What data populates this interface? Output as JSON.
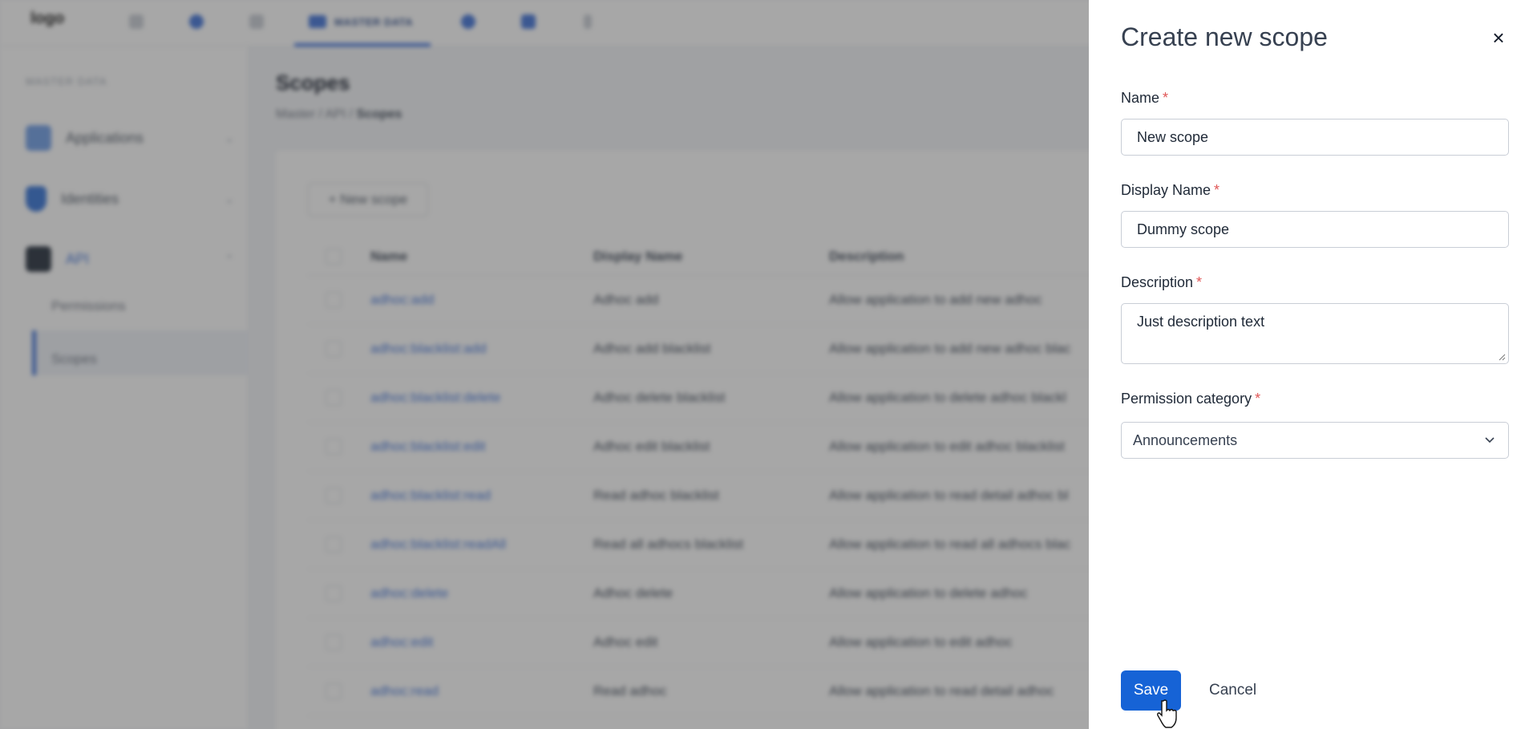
{
  "app": {
    "logo_alt": "logo",
    "active_tab": "MASTER DATA"
  },
  "sidebar": {
    "section_title": "MASTER DATA",
    "items": [
      {
        "label": "Applications"
      },
      {
        "label": "Identities"
      },
      {
        "label": "API"
      }
    ],
    "sub_items": [
      {
        "label": "Permissions"
      },
      {
        "label": "Scopes"
      }
    ]
  },
  "page": {
    "title": "Scopes",
    "breadcrumbs": [
      "Master",
      "API",
      "Scopes"
    ],
    "new_button": "+ New scope"
  },
  "table": {
    "headers": [
      "Name",
      "Display Name",
      "Description"
    ],
    "rows": [
      {
        "name": "adhoc:add",
        "display": "Adhoc add",
        "description": "Allow application to add new adhoc"
      },
      {
        "name": "adhoc:blacklist:add",
        "display": "Adhoc add blacklist",
        "description": "Allow application to add new adhoc blac"
      },
      {
        "name": "adhoc:blacklist:delete",
        "display": "Adhoc delete blacklist",
        "description": "Allow application to delete adhoc blackl"
      },
      {
        "name": "adhoc:blacklist:edit",
        "display": "Adhoc edit blacklist",
        "description": "Allow application to edit adhoc blacklist"
      },
      {
        "name": "adhoc:blacklist:read",
        "display": "Read adhoc blacklist",
        "description": "Allow application to read detail adhoc bl"
      },
      {
        "name": "adhoc:blacklist:readAll",
        "display": "Read all adhocs blacklist",
        "description": "Allow application to read all adhocs blac"
      },
      {
        "name": "adhoc:delete",
        "display": "Adhoc delete",
        "description": "Allow application to delete adhoc"
      },
      {
        "name": "adhoc:edit",
        "display": "Adhoc edit",
        "description": "Allow application to edit adhoc"
      },
      {
        "name": "adhoc:read",
        "display": "Read adhoc",
        "description": "Allow application to read detail adhoc"
      }
    ]
  },
  "drawer": {
    "title": "Create new scope",
    "name_label": "Name",
    "name_value": "New scope",
    "display_name_label": "Display Name",
    "display_name_value": "Dummy scope",
    "description_label": "Description",
    "description_value": "Just description text",
    "category_label": "Permission category",
    "category_value": "Announcements",
    "required_mark": "*",
    "save_label": "Save",
    "cancel_label": "Cancel",
    "close_icon": "×"
  },
  "colors": {
    "primary": "#1663d6",
    "required": "#e05656",
    "overlay": "rgba(60,60,60,0.45)"
  }
}
